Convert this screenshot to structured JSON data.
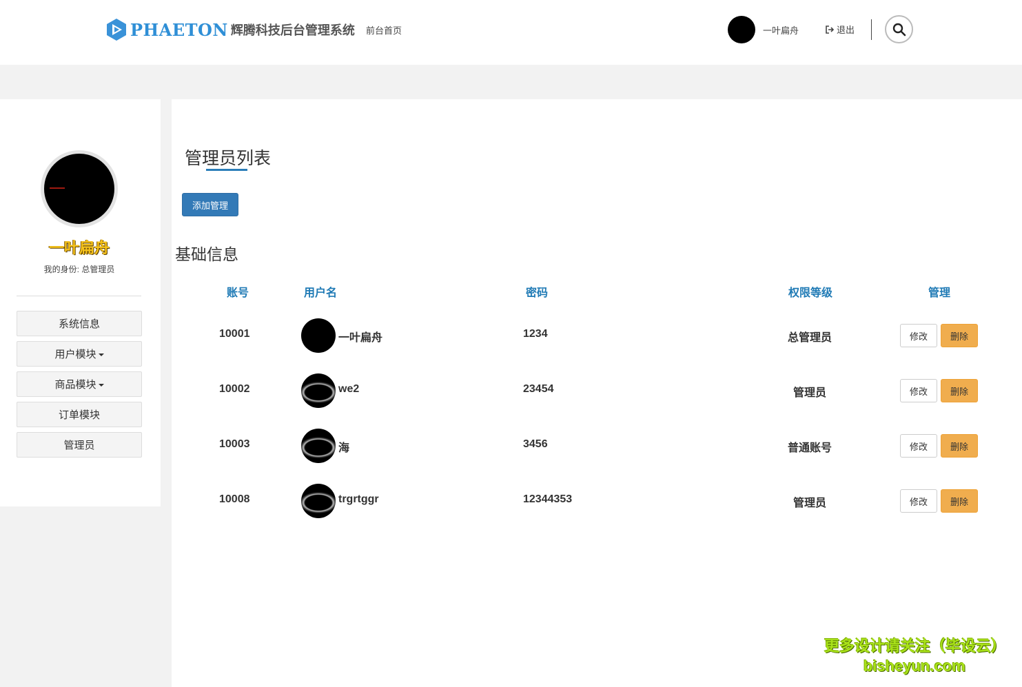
{
  "header": {
    "logo_word": "PHAETON",
    "logo_cn": "辉腾科技后台管理系统",
    "nav_front": "前台首页",
    "user_name": "一叶扁舟",
    "logout_label": "退出",
    "logo_color": "#2f8fd6"
  },
  "sidebar": {
    "profile_name": "一叶扁舟",
    "profile_role": "我的身份: 总管理员",
    "items": [
      {
        "label": "系统信息",
        "dropdown": false
      },
      {
        "label": "用户模块",
        "dropdown": true
      },
      {
        "label": "商品模块",
        "dropdown": true
      },
      {
        "label": "订单模块",
        "dropdown": false
      },
      {
        "label": "管理员",
        "dropdown": false
      }
    ]
  },
  "main": {
    "page_title": "管理员列表",
    "add_button": "添加管理",
    "section_title": "基础信息",
    "columns": {
      "account": "账号",
      "username": "用户名",
      "password": "密码",
      "level": "权限等级",
      "manage": "管理"
    },
    "rows": [
      {
        "account": "10001",
        "username": "一叶扁舟",
        "password": "1234",
        "level": "总管理员",
        "edit": "修改",
        "delete": "删除"
      },
      {
        "account": "10002",
        "username": "we2",
        "password": "23454",
        "level": "管理员",
        "edit": "修改",
        "delete": "删除"
      },
      {
        "account": "10003",
        "username": "海",
        "password": "3456",
        "level": "普通账号",
        "edit": "修改",
        "delete": "删除"
      },
      {
        "account": "10008",
        "username": "trgrtggr",
        "password": "12344353",
        "level": "管理员",
        "edit": "修改",
        "delete": "删除"
      }
    ],
    "accent_color": "#1f7ab5",
    "primary_button_color": "#337ab7",
    "warning_button_color": "#f0ad4e"
  },
  "watermark": {
    "line1": "更多设计请关注（毕设云）",
    "line2": "bisheyun.com"
  }
}
